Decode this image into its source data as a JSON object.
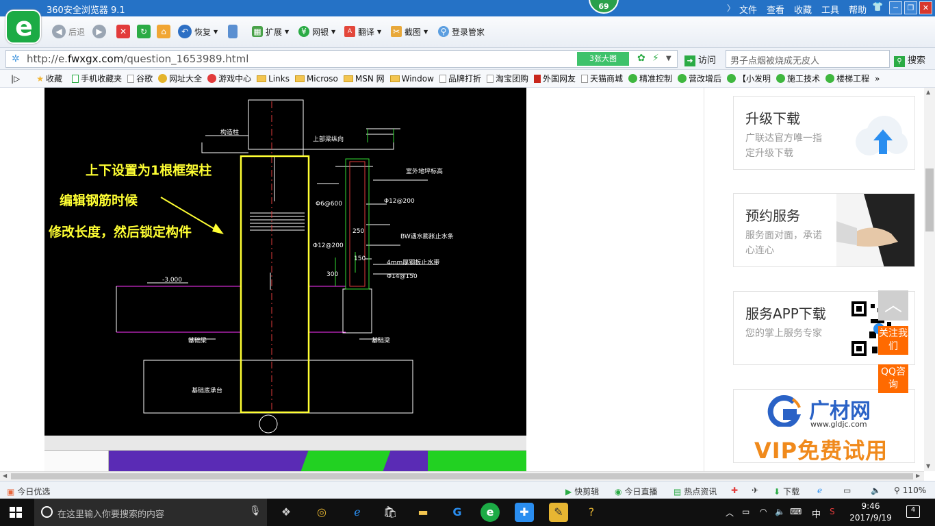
{
  "window": {
    "title": "360安全浏览器 9.1",
    "badge": "69",
    "menu": [
      "文件",
      "查看",
      "收藏",
      "工具",
      "帮助"
    ]
  },
  "toolbar": {
    "back": "后退",
    "restore": "恢复",
    "extend": "扩展",
    "bank": "网银",
    "translate": "翻译",
    "screenshot": "截图",
    "login": "登录管家"
  },
  "address": {
    "url_prefix": "http://e.",
    "url_domain": "fwxgx.com",
    "url_path": "/question_1653989.html",
    "image_count": "3张大图",
    "visit": "访问",
    "search_placeholder": "男子点烟被烧成无皮人",
    "search_button": "搜索"
  },
  "bookmarks": [
    "收藏",
    "手机收藏夹",
    "谷歌",
    "网址大全",
    "游戏中心",
    "Links",
    "Microso",
    "MSN 网",
    "Window",
    "品牌打折",
    "淘宝团购",
    "外国网友",
    "天猫商城",
    "精准控制",
    "营改增后",
    "【小发明",
    "施工技术",
    "楼梯工程"
  ],
  "cad": {
    "caption1": "上下设置为1根框架柱",
    "caption2": "编辑钢筋时候",
    "caption3": "修改长度，然后锁定构件",
    "labels": [
      "构造柱",
      "上部梁纵向",
      "室外地坪标高",
      "Φ6@600",
      "Φ12@200",
      "250",
      "BW遇水膨胀止水条",
      "4mm厚钢板止水带",
      "Φ14@150",
      "300",
      "-3.000",
      "基础梁",
      "基础梁",
      "基础底承台",
      "Φ12@200",
      "150"
    ]
  },
  "sidebar": {
    "upgrade": {
      "title": "升级下载",
      "sub": "广联达官方唯一指定升级下载"
    },
    "booking": {
      "title": "预约服务",
      "sub": "服务面对面，承诺心连心"
    },
    "app": {
      "title": "服务APP下载",
      "sub": "您的掌上服务专家"
    },
    "ad": {
      "brand": "广材网",
      "url": "www.gldjc.com",
      "promo": "VIP免费试用"
    }
  },
  "float": {
    "follow": "关注我们",
    "qq": "QQ咨询"
  },
  "statusbar": {
    "today": "今日优选",
    "kuaijian": "快剪辑",
    "live": "今日直播",
    "news": "热点资讯",
    "download": "下载",
    "zoom": "110%"
  },
  "taskbar": {
    "search_placeholder": "在这里输入你要搜索的内容",
    "ime": "中",
    "time": "9:46",
    "date": "2017/9/19",
    "notifications": "4"
  },
  "colors": {
    "titlebar": "#2572c6",
    "accent_green": "#3ec26b",
    "orange": "#ff6a00",
    "cad_bg": "#000000",
    "caption": "#ffff33"
  }
}
